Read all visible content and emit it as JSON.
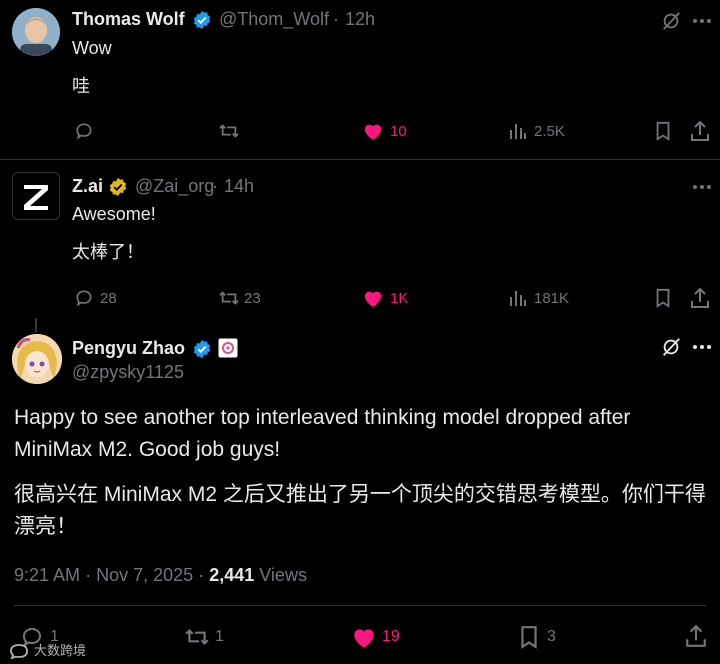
{
  "tweets": [
    {
      "name": "Thomas Wolf",
      "handle": "@Thom_Wolf",
      "sep": "·",
      "time": "12h",
      "lines": [
        "Wow",
        "哇"
      ],
      "actions": {
        "replies": "",
        "reposts": "",
        "likes": "10",
        "views": "2.5K"
      },
      "liked": true,
      "verified": "blue"
    },
    {
      "name": "Z.ai",
      "handle": "@Zai_org",
      "sep": "·",
      "time": "14h",
      "lines": [
        "Awesome!",
        "太棒了！"
      ],
      "actions": {
        "replies": "28",
        "reposts": "23",
        "likes": "1K",
        "views": "181K"
      },
      "liked": true,
      "verified": "gold",
      "avatar_text": "Z"
    }
  ],
  "main_tweet": {
    "name": "Pengyu Zhao",
    "handle": "@zpysky1125",
    "text_en_1": "Happy to see another top interleaved thinking model dropped after",
    "text_en_2": "MiniMax M2. Good job guys!",
    "text_zh_1": "很高兴在 MiniMax M2 之后又推出了另一个顶尖的交错思考模型。你们干得",
    "text_zh_2": "漂亮！",
    "time": "9:21 AM",
    "date": "Nov 7, 2025",
    "sep": "·",
    "views_count": "2,441",
    "views_label": "Views",
    "actions": {
      "replies": "1",
      "reposts": "1",
      "likes": "19",
      "bookmarks": "3"
    }
  },
  "watermark": "大数跨境",
  "colors": {
    "accent_like": "#f91880",
    "verified_blue": "#1d9bf0",
    "verified_gold": "#e2b719",
    "muted": "#71767b"
  }
}
